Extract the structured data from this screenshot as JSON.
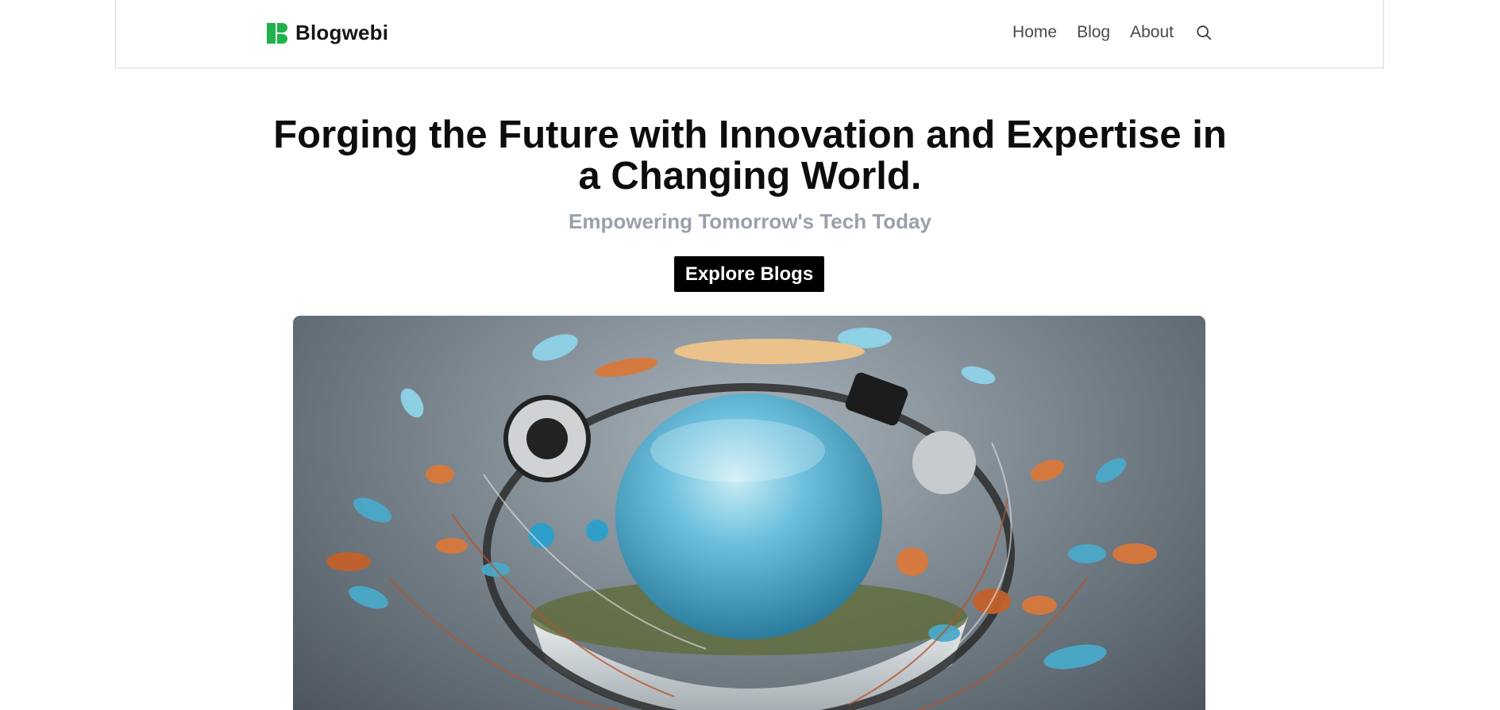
{
  "brand": {
    "name": "Blogwebi",
    "logo_color": "#1fb34a"
  },
  "nav": {
    "items": [
      {
        "label": "Home"
      },
      {
        "label": "Blog"
      },
      {
        "label": "About"
      }
    ],
    "search_icon": "search-icon"
  },
  "hero": {
    "title_line1": "Forging the Future with Innovation and Expertise in",
    "title_line2": "a Changing World.",
    "subtitle": "Empowering Tomorrow's Tech Today",
    "cta_label": "Explore Blogs"
  },
  "image": {
    "subject": "robotic-sphere-illustration",
    "accent_colors": [
      "#4aa9c9",
      "#d9793c",
      "#8fd3e8"
    ]
  }
}
